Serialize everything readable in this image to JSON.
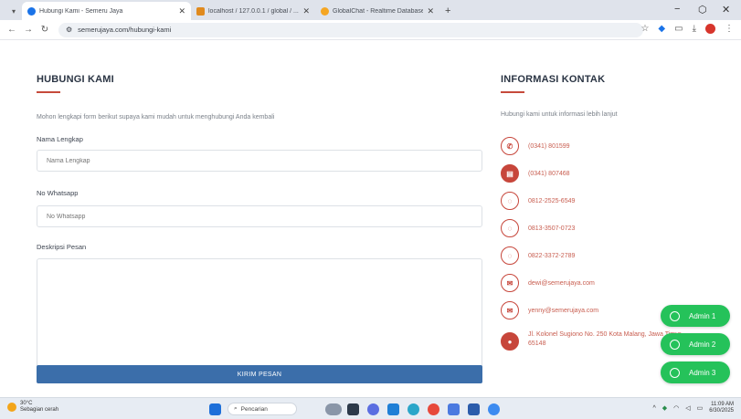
{
  "browser": {
    "tabs": [
      {
        "label": "Hubungi Kami - Semeru Jaya",
        "color": "#1a73e8"
      },
      {
        "label": "localhost / 127.0.0.1 / global / ...",
        "color": "#e08a1e"
      },
      {
        "label": "GlobalChat - Realtime Database ...",
        "color": "#f5a623"
      }
    ],
    "url": "semerujaya.com/hubungi-kami"
  },
  "form": {
    "title": "HUBUNGI KAMI",
    "description": "Mohon lengkapi form berikut supaya kami mudah untuk menghubungi Anda kembali",
    "name_label": "Nama Lengkap",
    "name_placeholder": "Nama Lengkap",
    "wa_label": "No Whatsapp",
    "wa_placeholder": "No Whatsapp",
    "msg_label": "Deskripsi Pesan",
    "submit_label": "KIRIM PESAN"
  },
  "contact": {
    "title": "INFORMASI KONTAK",
    "description": "Hubungi kami untuk informasi lebih lanjut",
    "items": [
      {
        "icon": "phone-icon",
        "text": "(0341) 801599"
      },
      {
        "icon": "fax-icon",
        "text": "(0341) 807468"
      },
      {
        "icon": "whatsapp-icon",
        "text": "0812-2525-6549"
      },
      {
        "icon": "whatsapp-icon",
        "text": "0813-3507-0723"
      },
      {
        "icon": "whatsapp-icon",
        "text": "0822-3372-2789"
      },
      {
        "icon": "mail-icon",
        "text": "dewi@semerujaya.com"
      },
      {
        "icon": "mail-icon",
        "text": "yenny@semerujaya.com"
      },
      {
        "icon": "location-icon",
        "text": "Jl. Kolonel Sugiono No. 250 Kota Malang, Jawa Timur, 65148"
      }
    ]
  },
  "admins": [
    "Admin 1",
    "Admin 2",
    "Admin 3"
  ],
  "taskbar": {
    "temp": "30°C",
    "weather": "Sebagian cerah",
    "search": "Pencarian",
    "time": "11:09 AM",
    "date": "6/30/2025"
  },
  "colors": {
    "accent": "#c7463b",
    "button": "#3b6eaa",
    "whatsapp": "#25c25a"
  }
}
